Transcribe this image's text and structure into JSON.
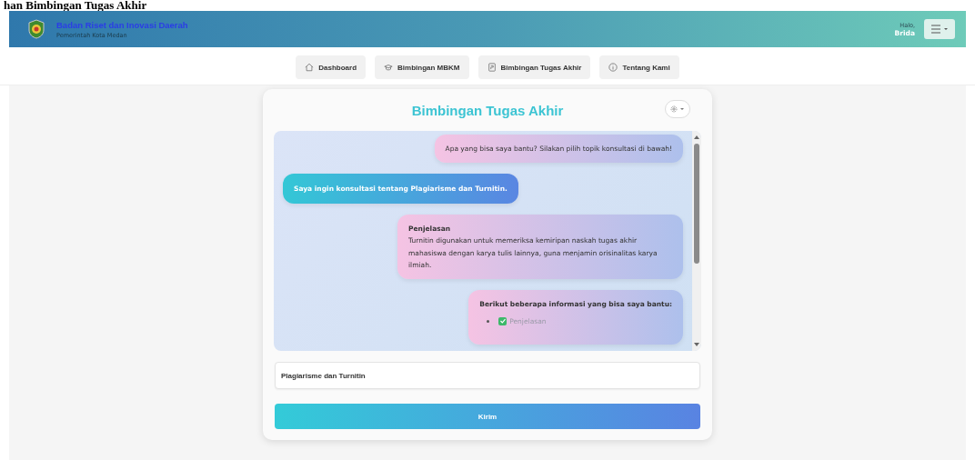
{
  "caption": "han Bimbingan Tugas Akhir",
  "header": {
    "title": "Badan Riset dan Inovasi Daerah",
    "subtitle": "Pemerintah Kota Medan",
    "greeting": "Halo,",
    "user": "Brida"
  },
  "nav": [
    {
      "label": "Dashboard"
    },
    {
      "label": "Bimbingan MBKM"
    },
    {
      "label": "Bimbingan Tugas Akhir"
    },
    {
      "label": "Tentang Kami"
    }
  ],
  "card": {
    "title": "Bimbingan Tugas Akhir"
  },
  "messages": [
    {
      "kind": "bot",
      "text": "Apa yang bisa saya bantu? Silakan pilih topik konsultasi di bawah!"
    },
    {
      "kind": "user",
      "text": "Saya ingin konsultasi tentang Plagiarisme dan Turnitin."
    },
    {
      "kind": "bot",
      "title": "Penjelasan",
      "text": "Turnitin digunakan untuk memeriksa kemiripan naskah tugas akhir mahasiswa dengan karya tulis lainnya, guna menjamin orisinalitas karya ilmiah."
    },
    {
      "kind": "bot",
      "title": "Berikut beberapa informasi yang bisa saya bantu:",
      "items": [
        {
          "label": "Penjelasan",
          "done": true
        }
      ]
    }
  ],
  "input": {
    "value": "Plagiarisme dan Turnitin"
  },
  "send_button": "Kirim"
}
